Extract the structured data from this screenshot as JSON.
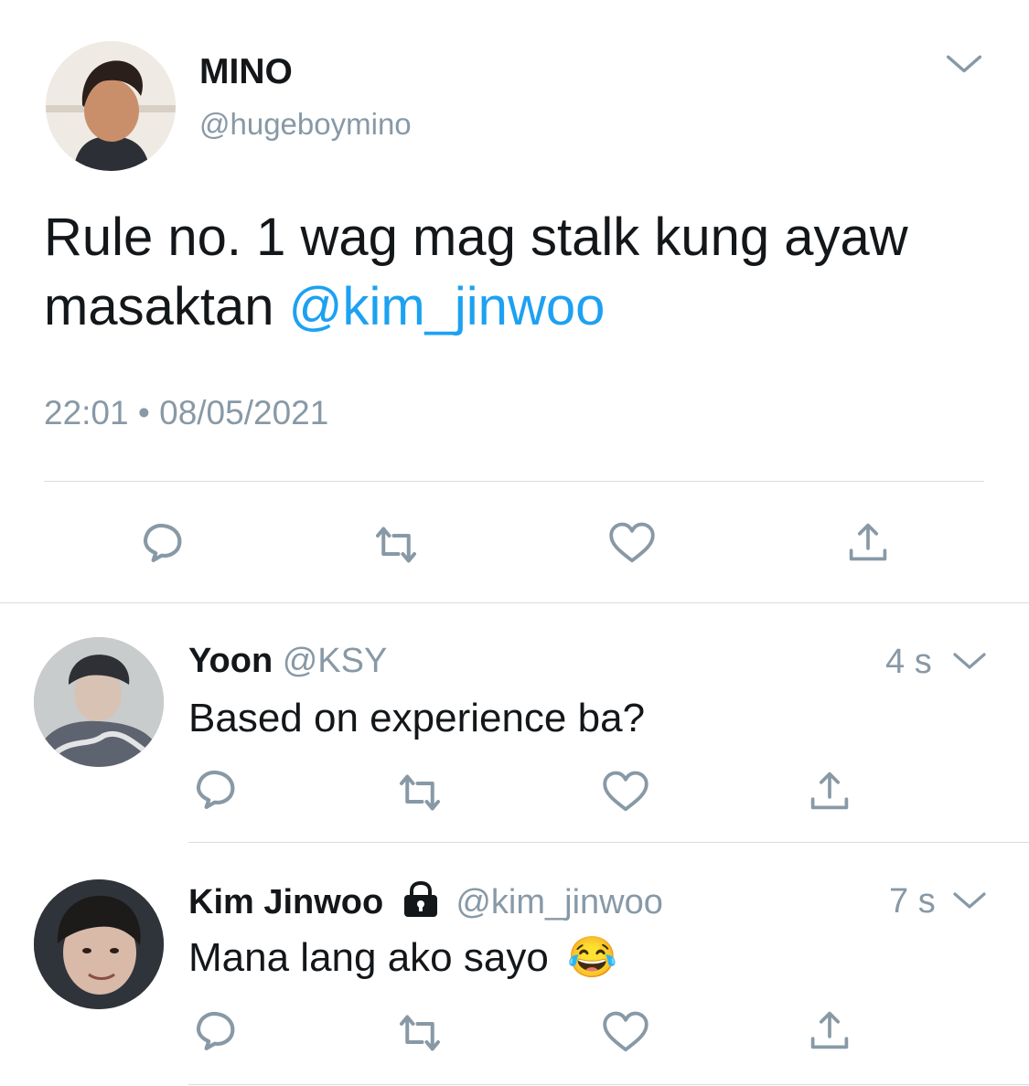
{
  "main_tweet": {
    "author_name": "MINO",
    "author_handle": "@hugeboymino",
    "text": "Rule no. 1 wag mag stalk kung ayaw masaktan ",
    "mention": "@kim_jinwoo",
    "time": "22:01",
    "separator": "•",
    "date": "08/05/2021"
  },
  "replies": [
    {
      "author_name": "Yoon",
      "author_handle": "@KSY",
      "time_ago": "4 s",
      "text": "Based on experience ba?"
    },
    {
      "author_name": "Kim Jinwoo",
      "author_handle": "@kim_jinwoo",
      "time_ago": "7 s",
      "text": "Mana lang ako sayo",
      "emoji": "😂",
      "protected": true
    }
  ],
  "icons": {
    "reply": "comment-icon",
    "retweet": "retweet-icon",
    "like": "heart-icon",
    "share": "share-icon",
    "menu": "chevron-down-icon",
    "protected": "lock-icon"
  },
  "colors": {
    "link": "#1da1f2",
    "muted": "#8899a6",
    "divider": "#d8dde1"
  }
}
